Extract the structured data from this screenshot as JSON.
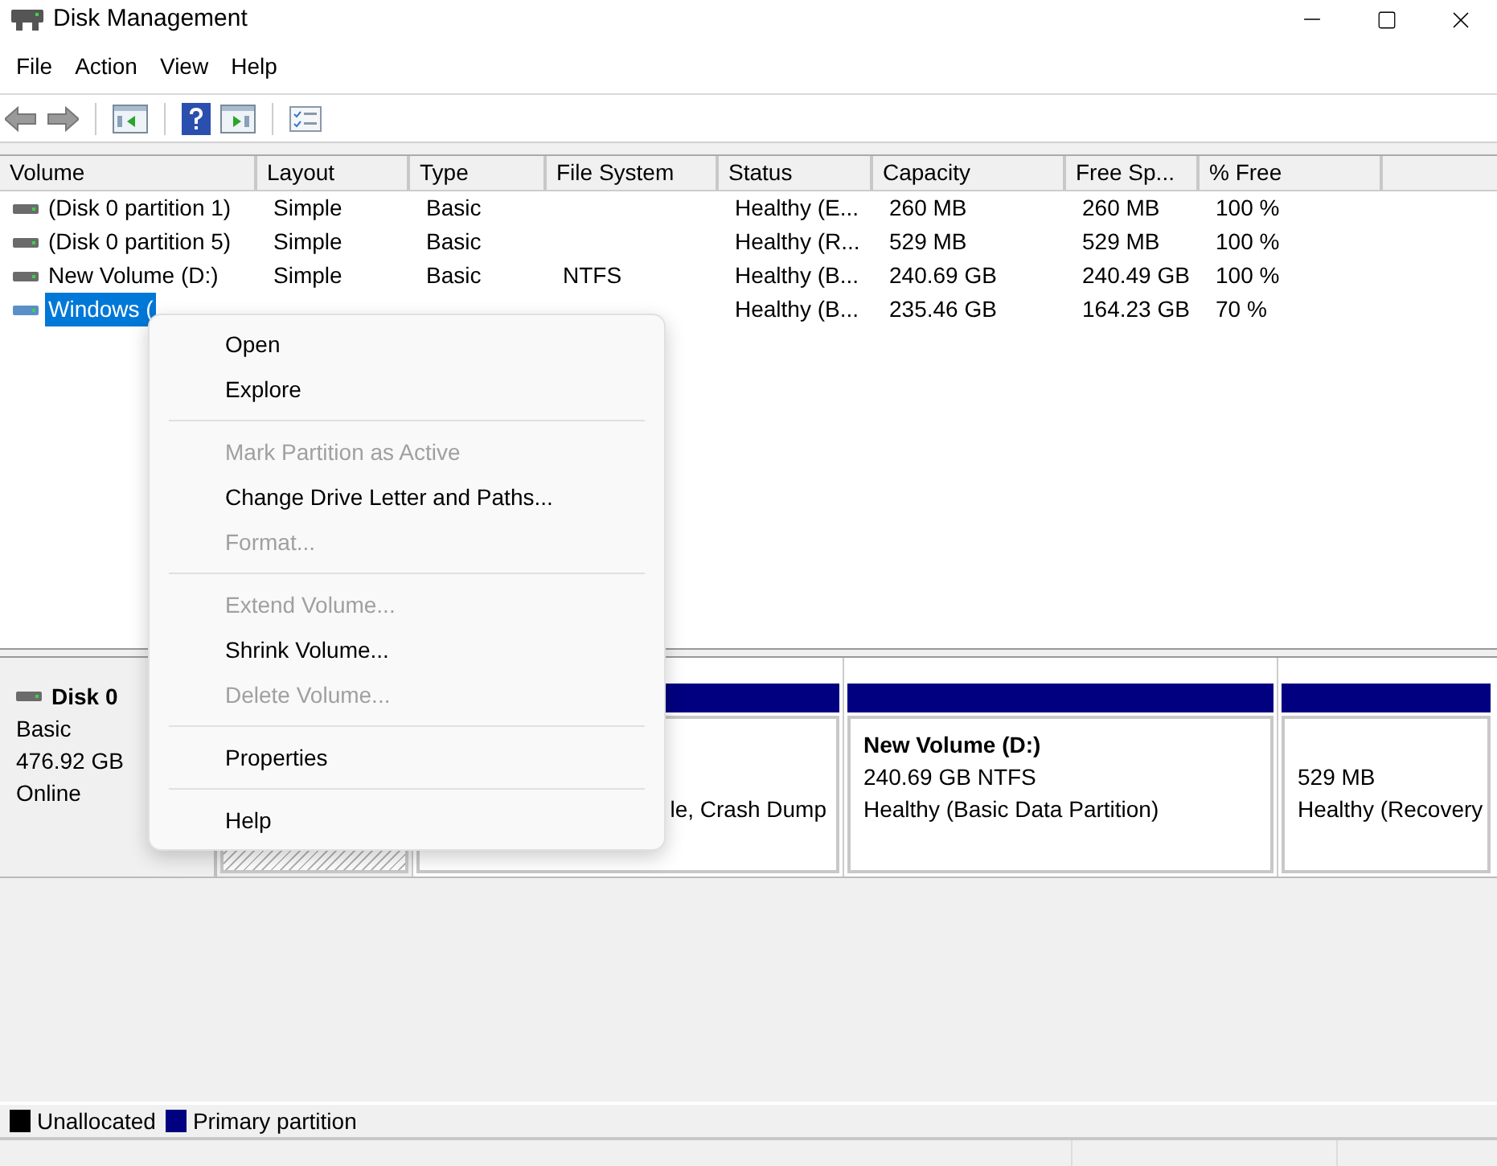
{
  "window": {
    "title": "Disk Management"
  },
  "menu": [
    "File",
    "Action",
    "View",
    "Help"
  ],
  "table": {
    "columns": [
      "Volume",
      "Layout",
      "Type",
      "File System",
      "Status",
      "Capacity",
      "Free Sp...",
      "% Free"
    ],
    "rows": [
      {
        "volume": "(Disk 0 partition 1)",
        "layout": "Simple",
        "type": "Basic",
        "status": "Healthy (E...",
        "capacity": "260 MB",
        "free": "260 MB",
        "pct": "100 %",
        "selected": false
      },
      {
        "volume": "(Disk 0 partition 5)",
        "layout": "Simple",
        "type": "Basic",
        "status": "Healthy (R...",
        "capacity": "529 MB",
        "free": "529 MB",
        "pct": "100 %",
        "selected": false
      },
      {
        "volume": "New Volume (D:)",
        "layout": "Simple",
        "type": "Basic",
        "fs": "NTFS",
        "status": "Healthy (B...",
        "capacity": "240.69 GB",
        "free": "240.49 GB",
        "pct": "100 %",
        "selected": false
      },
      {
        "volume": "Windows (",
        "status": "Healthy (B...",
        "capacity": "235.46 GB",
        "free": "164.23 GB",
        "pct": "70 %",
        "selected": true
      }
    ]
  },
  "disk": {
    "name": "Disk 0",
    "type": "Basic",
    "size": "476.92 GB",
    "state": "Online",
    "partitions": [
      {
        "kind": "hatched"
      },
      {
        "kind": "volume",
        "status": "le, Crash Dump"
      },
      {
        "kind": "volume",
        "title": "New Volume  (D:)",
        "size": "240.69 GB NTFS",
        "status": "Healthy (Basic Data Partition)"
      },
      {
        "kind": "volume",
        "size": "529 MB",
        "status": "Healthy (Recovery"
      }
    ]
  },
  "context_menu": [
    {
      "kind": "item",
      "label": "Open",
      "disabled": false
    },
    {
      "kind": "item",
      "label": "Explore",
      "disabled": false
    },
    {
      "kind": "separator"
    },
    {
      "kind": "item",
      "label": "Mark Partition as Active",
      "disabled": true
    },
    {
      "kind": "item",
      "label": "Change Drive Letter and Paths...",
      "disabled": false
    },
    {
      "kind": "item",
      "label": "Format...",
      "disabled": true
    },
    {
      "kind": "separator"
    },
    {
      "kind": "item",
      "label": "Extend Volume...",
      "disabled": true
    },
    {
      "kind": "item",
      "label": "Shrink Volume...",
      "disabled": false
    },
    {
      "kind": "item",
      "label": "Delete Volume...",
      "disabled": true
    },
    {
      "kind": "separator"
    },
    {
      "kind": "item",
      "label": "Properties",
      "disabled": false
    },
    {
      "kind": "separator"
    },
    {
      "kind": "item",
      "label": "Help",
      "disabled": false
    }
  ],
  "legend": [
    {
      "label": "Unallocated",
      "color": "#000000"
    },
    {
      "label": "Primary partition",
      "color": "#000080"
    }
  ]
}
